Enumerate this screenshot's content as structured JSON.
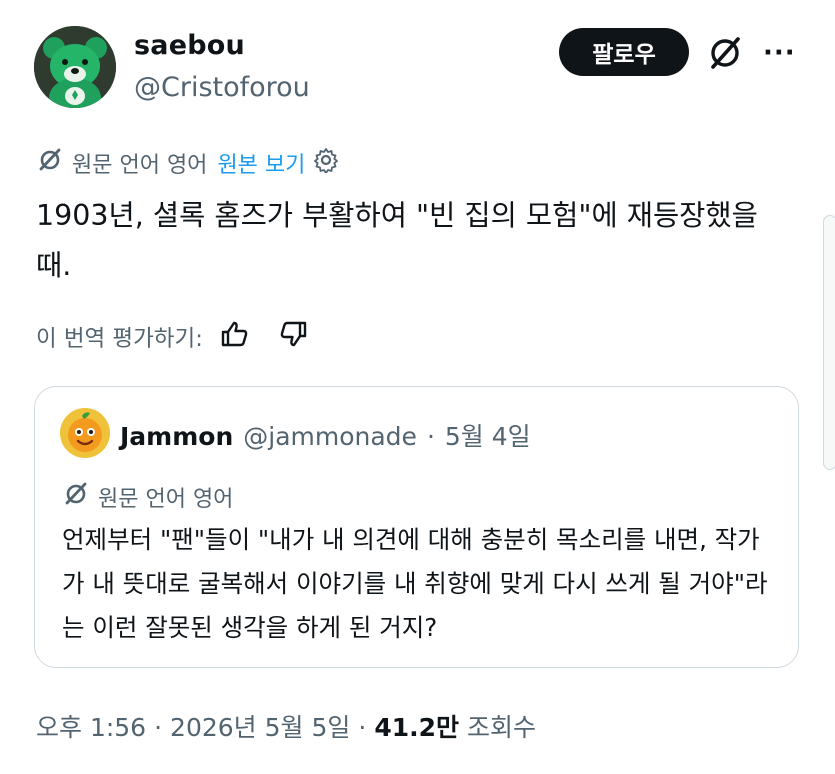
{
  "author": {
    "display_name": "saebou",
    "handle": "@Cristoforou",
    "follow_label": "팔로우"
  },
  "translation": {
    "original_language": "원문 언어 영어",
    "show_original": "원본 보기"
  },
  "tweet": {
    "text": "1903년, 셜록 홈즈가 부활하여 \"빈 집의 모험\"에 재등장했을 때."
  },
  "rating": {
    "label": "이 번역 평가하기:"
  },
  "quote": {
    "display_name": "Jammon",
    "handle": "@jammonade",
    "separator": "·",
    "date": "5월 4일",
    "original_language": "원문 언어 영어",
    "text": "언제부터 \"팬\"들이 \"내가 내 의견에 대해 충분히 목소리를 내면, 작가가 내 뜻대로 굴복해서 이야기를 내 취향에 맞게 다시 쓰게 될 거야\"라는 이런 잘못된 생각을 하게 된 거지?"
  },
  "footer": {
    "time": "오후 1:56",
    "separator": "·",
    "date": "2026년 5월 5일",
    "views_count": "41.2만",
    "views_label": "조회수"
  },
  "colors": {
    "accent": "#1d9bf0",
    "text": "#0f1419",
    "muted": "#536471",
    "border": "#cfd9de",
    "button_bg": "#0f1419"
  },
  "icons": [
    "grok-icon",
    "more-icon",
    "translate-icon",
    "settings-gear-icon",
    "thumbs-up-icon",
    "thumbs-down-icon"
  ]
}
